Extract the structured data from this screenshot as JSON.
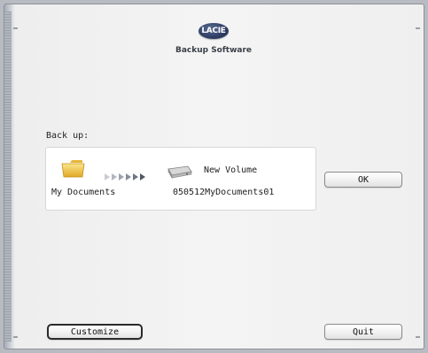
{
  "header": {
    "logo_text": "LACIE",
    "app_title": "Backup Software"
  },
  "backup": {
    "label": "Back up:",
    "source": {
      "name": "My Documents",
      "icon": "folder-icon"
    },
    "transfer_icon": "arrows-icon",
    "destination": {
      "volume": "New Volume",
      "folder": "050512MyDocuments01",
      "icon": "drive-icon"
    }
  },
  "buttons": {
    "ok_label": "OK",
    "customize_label": "Customize",
    "quit_label": "Quit"
  },
  "colors": {
    "background": "#f4f4f4",
    "logo": "#2e3d64",
    "folder": "#f0c94a",
    "arrows": "#5e6675"
  }
}
